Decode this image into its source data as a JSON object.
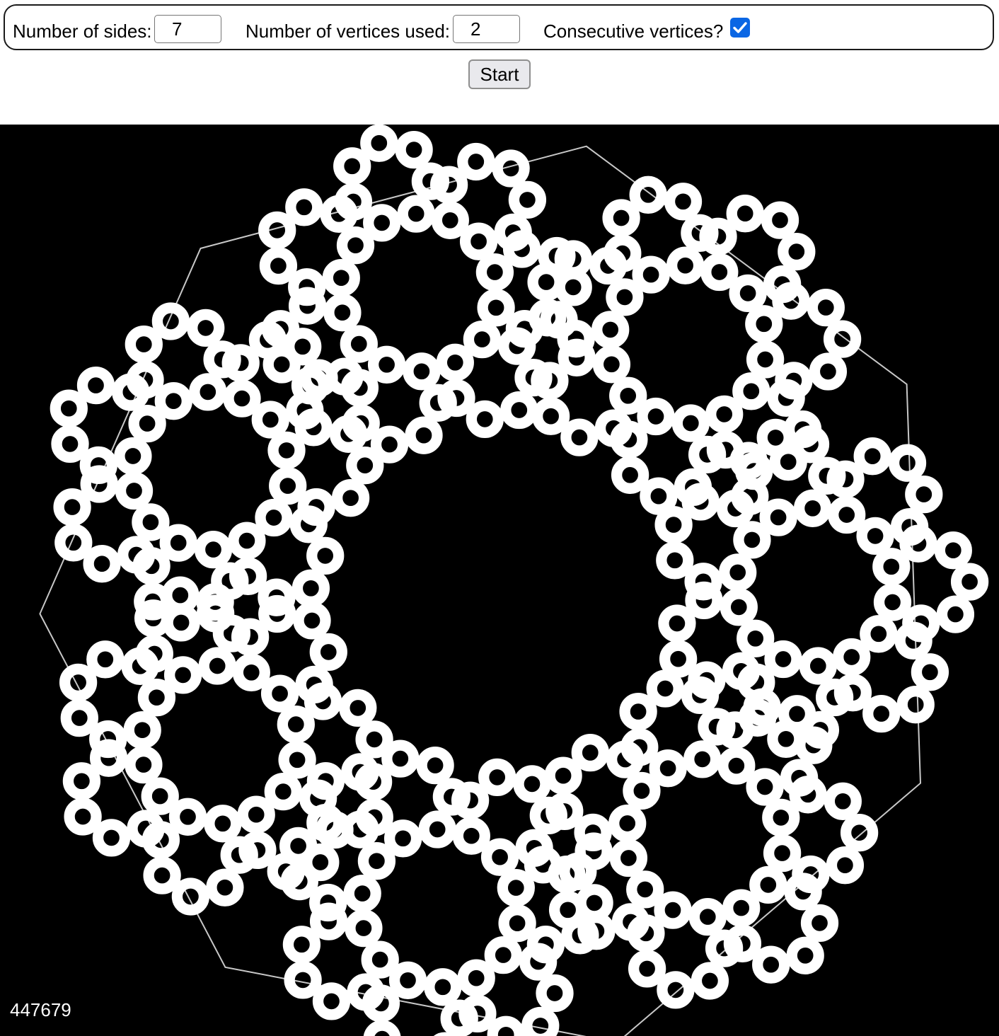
{
  "controls": {
    "sides_label": "Number of sides:",
    "sides_value": "7",
    "vertices_label": "Number of vertices used:",
    "vertices_value": "2",
    "consecutive_label": "Consecutive vertices?",
    "consecutive_checked": true,
    "start_label": "Start"
  },
  "canvas": {
    "background": "#000000",
    "point_color": "#ffffff",
    "outline_color": "#c8c8c8",
    "point_count": "447679",
    "accent_color": "#0a66e4"
  }
}
